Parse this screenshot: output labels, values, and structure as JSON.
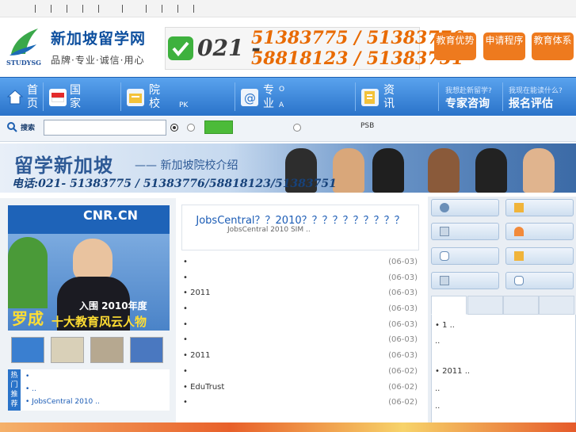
{
  "topbar": {
    "links": [
      "",
      "",
      "",
      "",
      "",
      "",
      "",
      "",
      "",
      ""
    ]
  },
  "header": {
    "logo_word": "STUDYSG",
    "site_name": "新加坡留学网",
    "slogan": "品牌·专业·诚信·用心",
    "phone_prefix": "021 -",
    "phone_line1": "51383775 / 51383776",
    "phone_line2": "58818123 / 51383751",
    "buttons": [
      {
        "label": "教育优势",
        "color": "#ee7a1e"
      },
      {
        "label": "申请程序",
        "color": "#ee7a1e"
      },
      {
        "label": "教育体系",
        "color": "#ee7a1e"
      }
    ]
  },
  "nav": {
    "home": "首页",
    "items": [
      {
        "label": "国家",
        "sub": ""
      },
      {
        "label": "院校",
        "sub": "PK"
      },
      {
        "label": "专业",
        "sub": "O",
        "sub2": "A"
      },
      {
        "label": "资讯",
        "sub": ""
      }
    ],
    "right": [
      {
        "question": "我想赴新留学?",
        "action": "专家咨询"
      },
      {
        "question": "我现在能读什么?",
        "action": "报名评估"
      }
    ]
  },
  "search": {
    "label": "搜索",
    "placeholder": "",
    "option1": "",
    "option2": "",
    "option3": "",
    "tag": "PSB"
  },
  "banner": {
    "title": "留学新加坡",
    "subtitle": "—— 新加坡院校介绍",
    "phone": "电话:021- 51383775 / 51383776/58818123/51383751"
  },
  "feature": {
    "logo": "CNR.CN",
    "name": "罗成",
    "caption1": "入围 2010年度",
    "caption2": "十大教育风云人物"
  },
  "hot": {
    "tag": "热门推荐",
    "items": [
      "•",
      "•                    ..",
      "• JobsCentral  2010         .."
    ]
  },
  "headline": {
    "title": "JobsCentral？？2010？？？？？？？？？？",
    "meta": "JobsCentral    2010           SIM        .."
  },
  "news": [
    {
      "title": "•",
      "date": "(06-03)"
    },
    {
      "title": "•",
      "date": "(06-03)"
    },
    {
      "title": "• 2011",
      "date": "(06-03)"
    },
    {
      "title": "•",
      "date": "(06-03)"
    },
    {
      "title": "•",
      "date": "(06-03)"
    },
    {
      "title": "•",
      "date": "(06-03)"
    },
    {
      "title": "• 2011",
      "date": "(06-03)"
    },
    {
      "title": "•",
      "date": "(06-02)"
    },
    {
      "title": "• EduTrust",
      "date": "(06-02)"
    },
    {
      "title": "•",
      "date": "(06-02)"
    }
  ],
  "side_tabs": {
    "items": [
      "•             1 ..",
      "                       ..",
      "• 2011             ..",
      "                       ..",
      "                       .."
    ]
  }
}
